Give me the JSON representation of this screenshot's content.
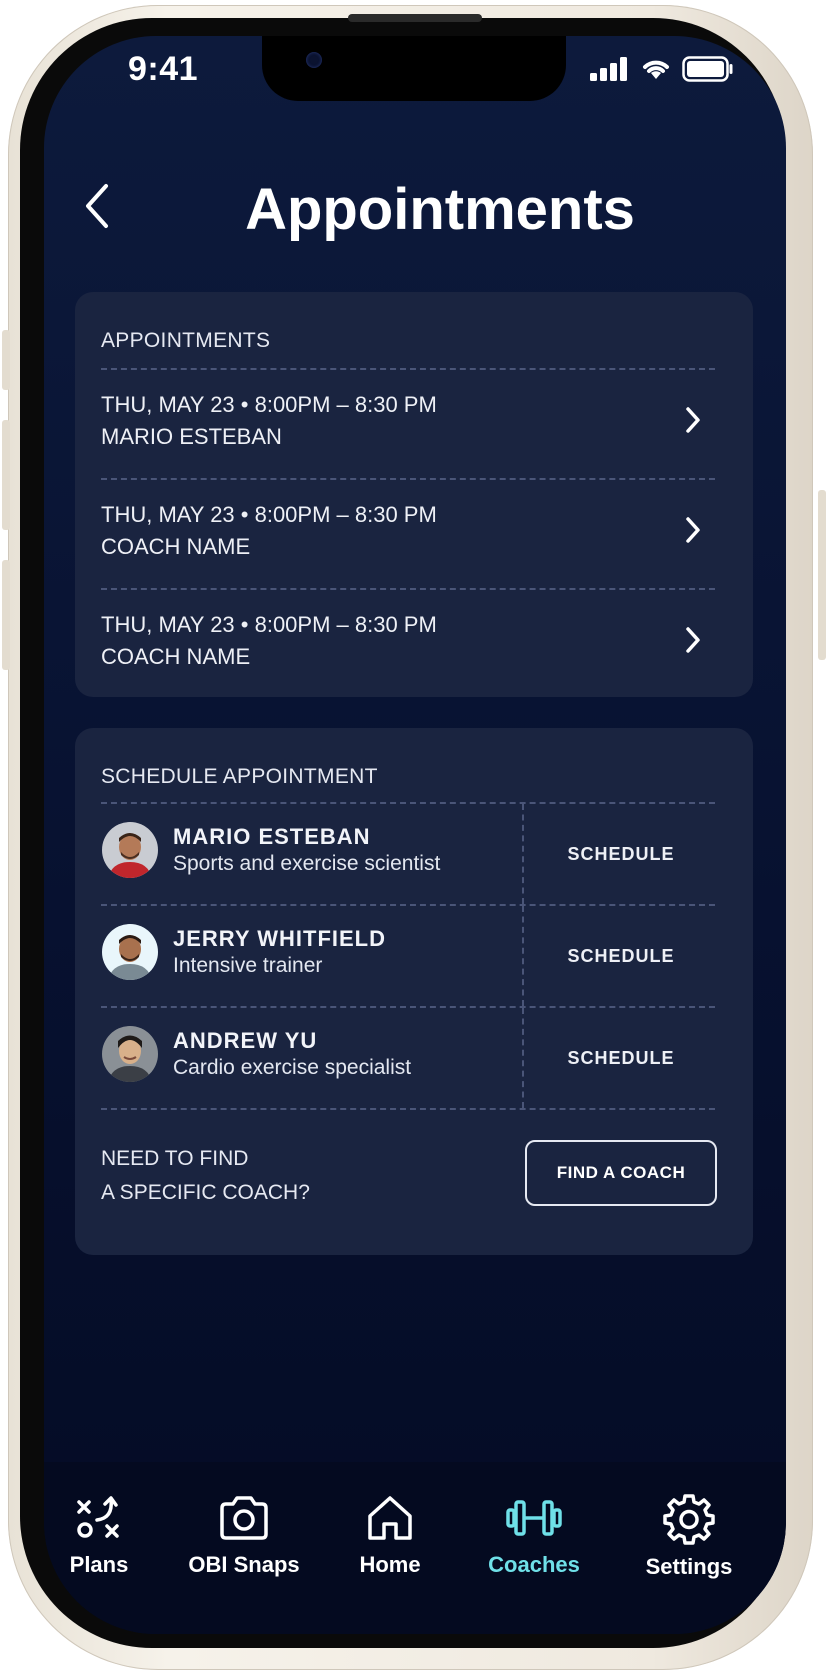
{
  "status_bar": {
    "time": "9:41"
  },
  "header": {
    "title": "Appointments"
  },
  "appointments": {
    "heading": "APPOINTMENTS",
    "items": [
      {
        "when": "THU, MAY 23 • 8:00PM – 8:30 PM",
        "coach": "MARIO ESTEBAN"
      },
      {
        "when": "THU, MAY 23 • 8:00PM – 8:30 PM",
        "coach": "COACH NAME"
      },
      {
        "when": "THU, MAY 23 • 8:00PM – 8:30 PM",
        "coach": "COACH NAME"
      }
    ]
  },
  "schedule": {
    "heading": "SCHEDULE APPOINTMENT",
    "coaches": [
      {
        "name": "MARIO ESTEBAN",
        "role": "Sports and exercise scientist",
        "action": "SCHEDULE"
      },
      {
        "name": "JERRY WHITFIELD",
        "role": "Intensive trainer",
        "action": "SCHEDULE"
      },
      {
        "name": "ANDREW YU",
        "role": "Cardio exercise specialist",
        "action": "SCHEDULE"
      }
    ],
    "find_prompt_line1": "NEED TO FIND",
    "find_prompt_line2": "A SPECIFIC COACH?",
    "find_button": "FIND A COACH"
  },
  "tabbar": {
    "items": [
      {
        "label": "Plans",
        "icon": "plans-icon"
      },
      {
        "label": "OBI Snaps",
        "icon": "camera-icon"
      },
      {
        "label": "Home",
        "icon": "home-icon"
      },
      {
        "label": "Coaches",
        "icon": "dumbbell-icon",
        "active": true
      },
      {
        "label": "Settings",
        "icon": "gear-icon"
      }
    ]
  },
  "colors": {
    "accent": "#6fe0e8",
    "card": "#1a2440",
    "background": "#071130"
  }
}
